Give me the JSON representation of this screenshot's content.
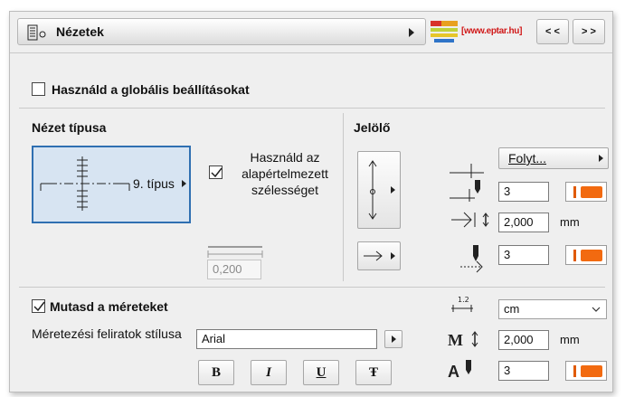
{
  "header": {
    "title": "Nézetek",
    "logo_text": "[www.eptar.hu]",
    "prev_label": "< <",
    "next_label": "> >"
  },
  "global_settings": {
    "label": "Használd a globális beállításokat",
    "checked": false
  },
  "view_type": {
    "section_label": "Nézet típusa",
    "type_label": "9. típus",
    "default_width_label": "Használd az alapértelmezett szélességet",
    "default_width_checked": true,
    "width_value": "0,200"
  },
  "marker": {
    "section_label": "Jelölő",
    "dropdown_value": "Folyt...",
    "pen_value": "3",
    "size_value": "2,000",
    "size_unit": "mm",
    "pen2_value": "3"
  },
  "dimensions": {
    "show_label": "Mutasd a méreteket",
    "show_checked": true,
    "label_style_caption": "Méretezési feliratok stílusa",
    "font_value": "Arial",
    "unit_value": "cm",
    "text_size_value": "2,000",
    "text_size_unit": "mm",
    "text_pen_value": "3",
    "bold_label": "B",
    "italic_label": "I",
    "underline_label": "U",
    "strike_label": "Ŧ"
  },
  "colors": {
    "accent_blue": "#2f6fb1",
    "pen_orange": "#f26a10"
  }
}
